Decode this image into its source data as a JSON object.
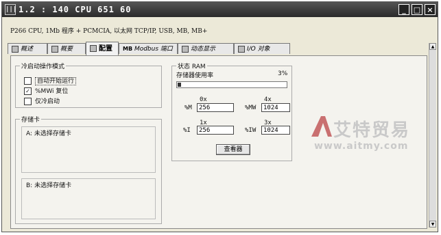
{
  "window": {
    "app_icon_text": "|||",
    "title": "1.2 : 140 CPU 651 60",
    "min_label": "_",
    "max_label": "□",
    "close_label": "×"
  },
  "info_line": "P266 CPU, 1Mb 程序 + PCMCIA, 以太网 TCP/IP, USB, MB, MB+",
  "tabs": [
    {
      "label": "概述",
      "active": false
    },
    {
      "label": "概要",
      "active": false
    },
    {
      "label": "配置",
      "active": true
    },
    {
      "label": "Modbus 端口",
      "badge": "MB",
      "active": false
    },
    {
      "label": "动态显示",
      "active": false
    },
    {
      "label": "I/O 对象",
      "active": false
    }
  ],
  "cold_start": {
    "title": "冷启动操作模式",
    "options": [
      {
        "label": "自动开始运行",
        "checked": false
      },
      {
        "label": "%MWi 复位",
        "checked": true
      },
      {
        "label": "仅冷启动",
        "checked": false
      }
    ]
  },
  "memory_card": {
    "title": "存储卡",
    "slot_a": "A: 未选择存储卡",
    "slot_b": "B: 未选择存储卡"
  },
  "status": {
    "title": "状态 RAM",
    "usage_label": "存储器使用率",
    "usage_percent": "3%",
    "usage_fraction": 0.03,
    "registers": [
      {
        "header": "0x",
        "label": "%M",
        "value": "256"
      },
      {
        "header": "4x",
        "label": "%MW",
        "value": "1024"
      },
      {
        "header": "1x",
        "label": "%I",
        "value": "256"
      },
      {
        "header": "3x",
        "label": "%IW",
        "value": "1024"
      }
    ],
    "view_button": "查看器"
  },
  "watermark": {
    "logo_letter": "A",
    "brand": "艾特贸易",
    "url": "www.aitmy.com"
  },
  "scroll": {
    "up_glyph": "▲",
    "down_glyph": "▼"
  }
}
